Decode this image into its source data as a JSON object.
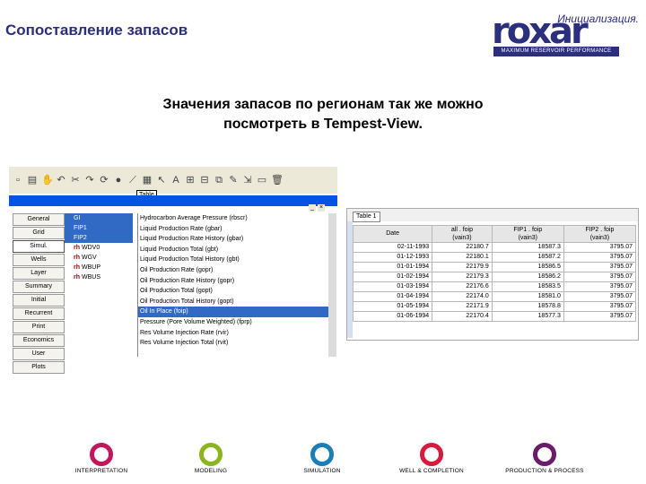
{
  "header": {
    "title": "Сопоставление запасов",
    "subtitle": "Инициализация.",
    "logo_word": "roxar",
    "logo_tagline": "MAXIMUM RESERVOIR PERFORMANCE",
    "headline_line1": "Значения запасов по регионам так же можно",
    "headline_line2": "посмотреть в Tempest-View."
  },
  "toolbar": {
    "tooltip": "Table"
  },
  "categories": [
    {
      "label": "General"
    },
    {
      "label": "Grid"
    },
    {
      "label": "Simul."
    },
    {
      "label": "Wells"
    },
    {
      "label": "Layer"
    },
    {
      "label": "Summary"
    },
    {
      "label": "Initial"
    },
    {
      "label": "Recurrent"
    },
    {
      "label": "Print"
    },
    {
      "label": "Economics"
    },
    {
      "label": "User"
    },
    {
      "label": "Plots"
    }
  ],
  "regions": [
    {
      "label": "GI"
    },
    {
      "label": "FIP1"
    },
    {
      "label": "FIP2"
    },
    {
      "label": "WDV0"
    },
    {
      "label": "WGV"
    },
    {
      "label": "WBUP"
    },
    {
      "label": "WBUS"
    }
  ],
  "properties": [
    "Hydrocarbon Average Pressure (rbscr)",
    "Liquid Production Rate (gbar)",
    "Liquid Production Rate History (gbar)",
    "Liquid Production Total (gbt)",
    "Liquid Production Total History (gbt)",
    "Oil Production Rate (gopr)",
    "Oil Production Rate History (gopr)",
    "Oil Production Total (gopt)",
    "Oil Production Total History (gopt)",
    "Oil In Place (foip)",
    "Pressure (Pore Volume Weighted) (fprp)",
    "Res Volume Injection Rate (rvir)",
    "Res Volume Injection Total (rvit)"
  ],
  "table": {
    "tab": "Table 1",
    "columns": [
      "Date",
      "all . foip\n(vain3)",
      "FIP1 . foip\n(vain3)",
      "FIP2 . foip\n(vain3)"
    ],
    "rows": [
      [
        "02-11-1993",
        "22180.7",
        "18587.3",
        "3795.07"
      ],
      [
        "01-12-1993",
        "22180.1",
        "18587.2",
        "3795.07"
      ],
      [
        "01-01-1994",
        "22179.9",
        "18586.5",
        "3795.07"
      ],
      [
        "01-02-1994",
        "22179.3",
        "18586.2",
        "3795.07"
      ],
      [
        "01-03-1994",
        "22176.6",
        "18583.5",
        "3795.07"
      ],
      [
        "01-04-1994",
        "22174.0",
        "18581.0",
        "3795.07"
      ],
      [
        "01-05-1994",
        "22171.9",
        "18578.8",
        "3795.07"
      ],
      [
        "01-06-1994",
        "22170.4",
        "18577.3",
        "3795.07"
      ]
    ]
  },
  "footer": [
    {
      "label": "INTERPRETATION",
      "color": "#c2185b"
    },
    {
      "label": "MODELING",
      "color": "#8ab51f"
    },
    {
      "label": "SIMULATION",
      "color": "#1a7fb4"
    },
    {
      "label": "WELL & COMPLETION",
      "color": "#d81b3c"
    },
    {
      "label": "PRODUCTION & PROCESS",
      "color": "#6a1b6a"
    }
  ]
}
